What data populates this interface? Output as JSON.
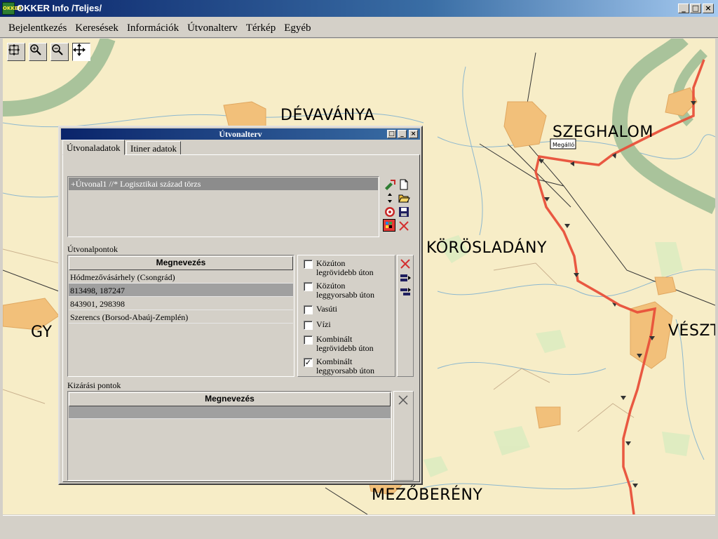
{
  "window": {
    "icon_text": "OKKER INFO",
    "title": "OKKER Info /Teljes/",
    "min": "_",
    "max": "□",
    "close": "×"
  },
  "menu": [
    "Bejelentkezés",
    "Keresések",
    "Információk",
    "Útvonalterv",
    "Térkép",
    "Egyéb"
  ],
  "map": {
    "towns": {
      "devavanya": "DÉVAVÁNYA",
      "szeghalom": "SZEGHALOM",
      "koroladany": "KÖRÖSLADÁNY",
      "veszto": "VÉSZT",
      "gy": "GY",
      "mezobereny": "MEZŐBERÉNY"
    },
    "stop_label": "Megálló",
    "route_color": "#e8503a",
    "river_color": "#a9c39b",
    "town_color": "#f2c07a",
    "background_color": "#f7edc7"
  },
  "tools": [
    "zoom-extent-icon",
    "zoom-in-icon",
    "zoom-out-icon",
    "pan-icon"
  ],
  "dialog": {
    "title": "Útvonalterv",
    "tabs": [
      "Útvonaladatok",
      "Itiner adatok"
    ],
    "route_item": "+Útvonal1 //* Logisztikai század törzs",
    "points_label": "Útvonalpontok",
    "points_header": "Megnevezés",
    "points": [
      "Hódmezővásárhely (Csongrád)",
      "813498, 187247",
      "843901, 298398",
      "Szerencs (Borsod-Abaúj-Zemplén)"
    ],
    "options": [
      {
        "line1": "Közúton",
        "line2": "legrövidebb úton",
        "checked": ""
      },
      {
        "line1": "Közúton",
        "line2": "leggyorsabb úton",
        "checked": ""
      },
      {
        "line1": "Vasúti",
        "line2": "",
        "checked": ""
      },
      {
        "line1": "Vízi",
        "line2": "",
        "checked": ""
      },
      {
        "line1": "Kombinált",
        "line2": "legrövidebb úton",
        "checked": ""
      },
      {
        "line1": "Kombinált",
        "line2": "leggyorsabb úton",
        "checked": "✓"
      }
    ],
    "exclusion_label": "Kizárási pontok",
    "exclusion_header": "Megnevezés"
  }
}
